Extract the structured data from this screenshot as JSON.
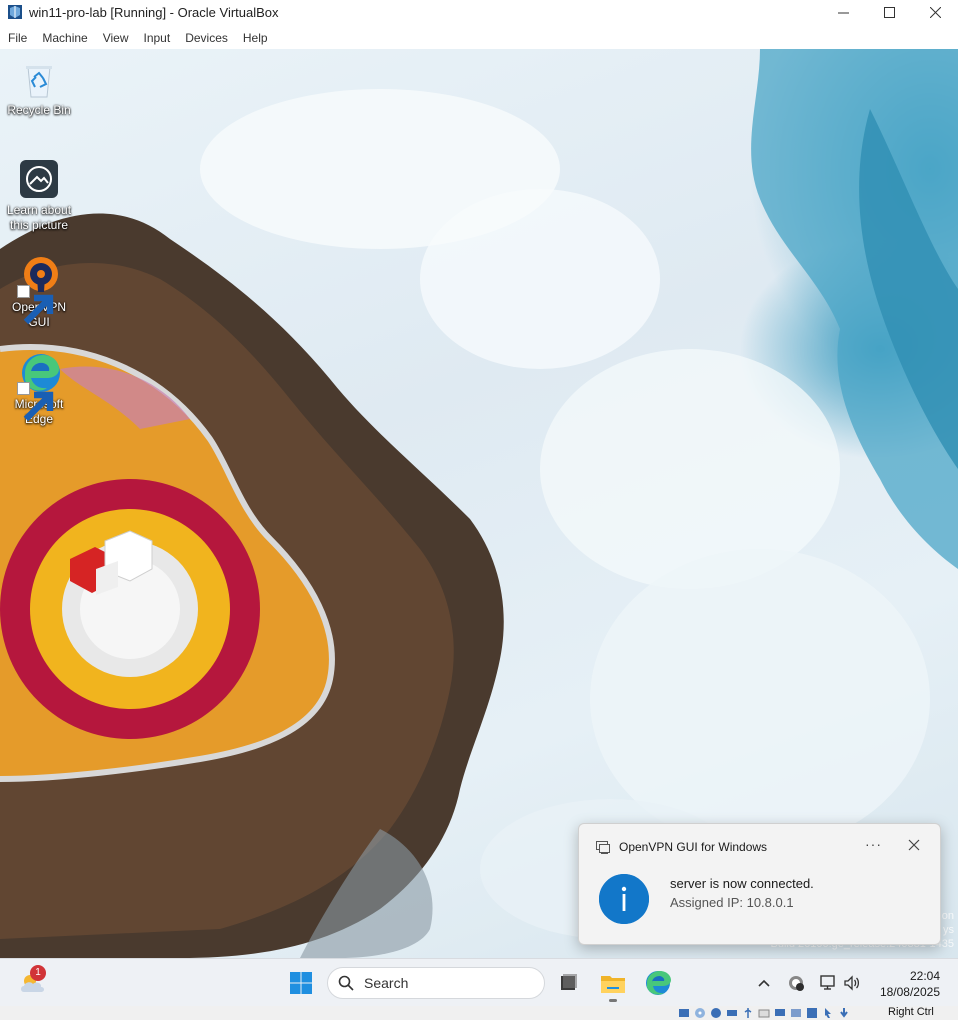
{
  "window": {
    "title": "win11-pro-lab [Running] - Oracle VirtualBox",
    "menu": [
      "File",
      "Machine",
      "View",
      "Input",
      "Devices",
      "Help"
    ]
  },
  "desktop": {
    "icons": [
      {
        "label": "Recycle Bin",
        "icon": "recycle-bin-icon"
      },
      {
        "label": "Learn about this picture",
        "icon": "learn-about-picture-icon"
      },
      {
        "label": "OpenVPN GUI",
        "icon": "openvpn-icon"
      },
      {
        "label": "Microsoft Edge",
        "icon": "edge-icon"
      }
    ],
    "watermark": {
      "line1": "on",
      "line2": "ys",
      "line3": "Build 26100.ge_release.240331-1435"
    }
  },
  "notification": {
    "app_name": "OpenVPN GUI for Windows",
    "more_label": "···",
    "message": "server is now connected.",
    "detail": "Assigned IP: 10.8.0.1",
    "icon": "info-icon"
  },
  "taskbar": {
    "weather_badge": "1",
    "search_placeholder": "Search",
    "time": "22:04",
    "date": "18/08/2025",
    "apps": [
      "task-view-icon",
      "file-explorer-icon",
      "edge-icon"
    ],
    "tray": [
      "chevron-up-icon",
      "openvpn-tray-icon",
      "network-icon",
      "volume-icon"
    ]
  },
  "statusbar": {
    "host_key": "Right Ctrl"
  },
  "colors": {
    "accent": "#1277c9",
    "notification_bg": "#f3f3f3",
    "taskbar_bg": "#eef1f5"
  }
}
